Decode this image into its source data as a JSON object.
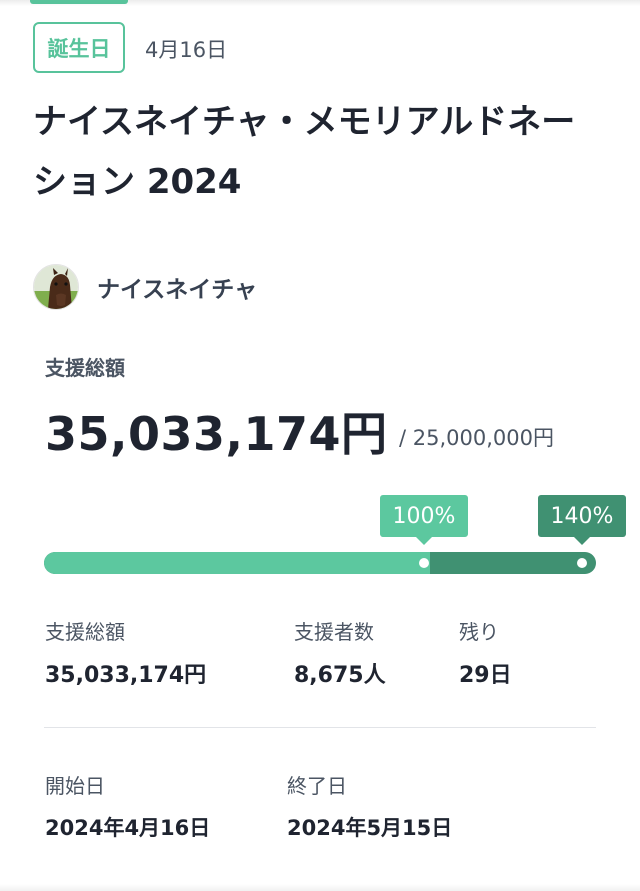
{
  "tag": {
    "label": "誕生日"
  },
  "event_date": "4月16日",
  "title": "ナイスネイチャ・メモリアルドネーション 2024",
  "owner": {
    "name": "ナイスネイチャ",
    "avatar_icon": "horse-avatar"
  },
  "funding": {
    "total_label": "支援総額",
    "total_amount": "35,033,174円",
    "goal": "/ 25,000,000円",
    "progress_fraction": 0.7,
    "milestones": [
      {
        "label": "100%",
        "color": "#5cc89f"
      },
      {
        "label": "140%",
        "color": "#409172"
      }
    ]
  },
  "stats": [
    {
      "label": "支援総額",
      "value": "35,033,174円"
    },
    {
      "label": "支援者数",
      "value": "8,675人"
    },
    {
      "label": "残り",
      "value": "29日"
    }
  ],
  "period": {
    "start_label": "開始日",
    "start_value": "2024年4月16日",
    "end_label": "終了日",
    "end_value": "2024年5月15日"
  },
  "colors": {
    "accent": "#58c39b",
    "accent_dark": "#409172",
    "text": "#1f2430"
  }
}
